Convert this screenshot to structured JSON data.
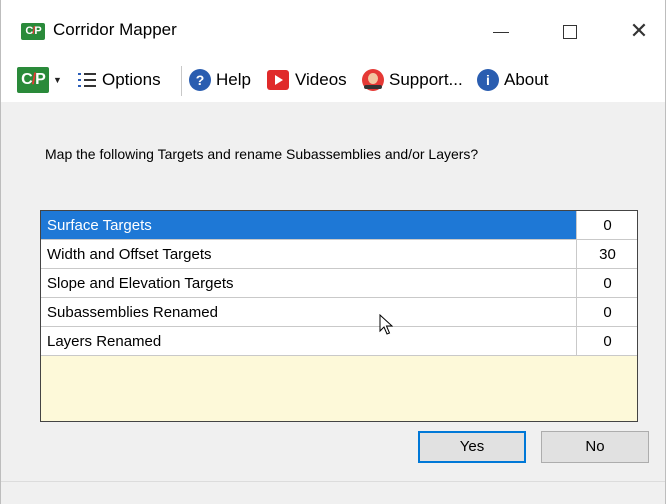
{
  "window": {
    "title": "Corridor Mapper",
    "app_logo": "C/P"
  },
  "toolbar": {
    "logo_label": "C/P",
    "options_label": "Options",
    "help_label": "Help",
    "videos_label": "Videos",
    "support_label": "Support...",
    "about_label": "About"
  },
  "dialog": {
    "prompt": "Map the following Targets and rename Subassemblies and/or Layers?",
    "rows": [
      {
        "label": "Surface Targets",
        "value": "0",
        "selected": true
      },
      {
        "label": "Width and Offset Targets",
        "value": "30",
        "selected": false
      },
      {
        "label": "Slope and Elevation Targets",
        "value": "0",
        "selected": false
      },
      {
        "label": "Subassemblies Renamed",
        "value": "0",
        "selected": false
      },
      {
        "label": "Layers Renamed",
        "value": "0",
        "selected": false
      }
    ],
    "yes_label": "Yes",
    "no_label": "No"
  },
  "colors": {
    "selection": "#1e78d6",
    "grid_empty": "#fdf9d9",
    "brand_green": "#2a8a3a",
    "help_blue": "#2a5db0",
    "video_red": "#e02a2a"
  }
}
